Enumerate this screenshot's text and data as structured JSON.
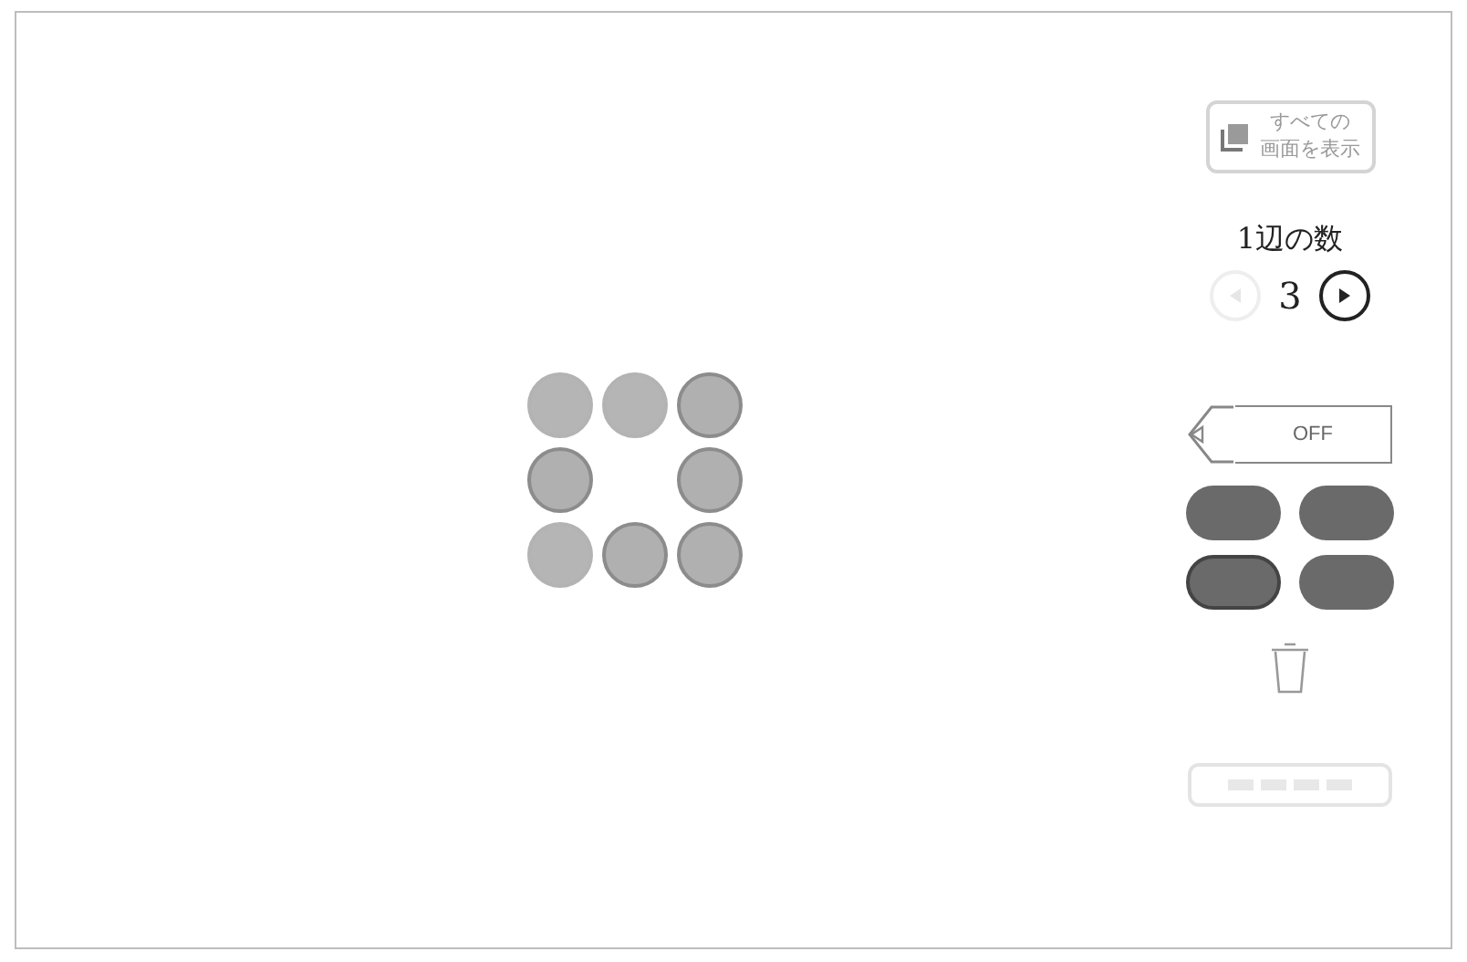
{
  "show_all_button": {
    "lines": [
      "すべての",
      "画面を表示"
    ]
  },
  "side_count": {
    "label": "1辺の数",
    "value": "3",
    "prev_disabled": true,
    "next_disabled": false
  },
  "pen": {
    "label": "OFF"
  },
  "palette": [
    {
      "color": "#6a6a6a",
      "selected": false
    },
    {
      "color": "#6a6a6a",
      "selected": false
    },
    {
      "color": "#6a6a6a",
      "selected": true
    },
    {
      "color": "#6a6a6a",
      "selected": false
    }
  ],
  "grid": [
    {
      "kind": "dot",
      "outlined": false
    },
    {
      "kind": "dot",
      "outlined": false
    },
    {
      "kind": "dot",
      "outlined": true
    },
    {
      "kind": "dot",
      "outlined": true
    },
    {
      "kind": "empty"
    },
    {
      "kind": "dot",
      "outlined": true
    },
    {
      "kind": "dot",
      "outlined": false
    },
    {
      "kind": "dot",
      "outlined": true
    },
    {
      "kind": "dot",
      "outlined": true
    }
  ],
  "bottom_button": {
    "disabled": true
  }
}
